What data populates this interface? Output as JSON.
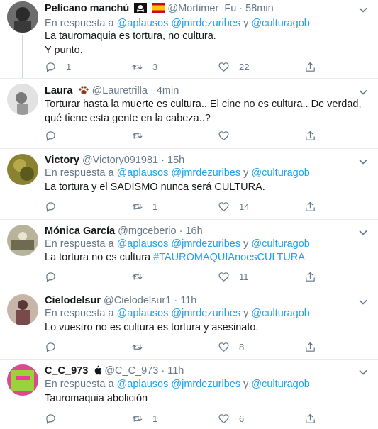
{
  "tweets": [
    {
      "name": "Pelícano manchú",
      "badges": [
        "pirate-flag-icon",
        "spain-flag-icon"
      ],
      "handle": "@Mortimer_Fu",
      "dot": "·",
      "time": "58min",
      "reply_prefix": "En respuesta a",
      "reply_mentions": [
        "@aplausos",
        "@jmrdezuribes",
        "@culturagob"
      ],
      "reply_joiner": "y",
      "text_lines": [
        "La tauromaquia es tortura, no cultura.",
        "Y punto."
      ],
      "replies": "1",
      "retweets": "3",
      "likes": "22",
      "avatar_color": "#5a5a5a"
    },
    {
      "name": "Laura",
      "badges": [
        "paw-print-icon"
      ],
      "handle": "@Lauretrilla",
      "dot": "·",
      "time": "4min",
      "reply_prefix": "",
      "reply_mentions": [],
      "reply_joiner": "",
      "text_lines": [
        "Torturar hasta la muerte es cultura.. El cine no es cultura.. De verdad,",
        "qué tiene esta gente en la cabeza..?"
      ],
      "replies": "",
      "retweets": "",
      "likes": "",
      "avatar_color": "#9a9a9a"
    },
    {
      "name": "Victory",
      "badges": [],
      "handle": "@Victory091981",
      "dot": "·",
      "time": "15h",
      "reply_prefix": "En respuesta a",
      "reply_mentions": [
        "@aplausos",
        "@jmrdezuribes",
        "@culturagob"
      ],
      "reply_joiner": "y",
      "text_lines": [
        "La tortura y el SADISMO nunca será CULTURA."
      ],
      "replies": "",
      "retweets": "1",
      "likes": "14",
      "avatar_color": "#7c7a2a"
    },
    {
      "name": "Mónica García",
      "badges": [],
      "handle": "@mgceberio",
      "dot": "·",
      "time": "16h",
      "reply_prefix": "En respuesta a",
      "reply_mentions": [
        "@aplausos",
        "@jmrdezuribes",
        "@culturagob"
      ],
      "reply_joiner": "y",
      "text_prefix": "La tortura no es cultura ",
      "hashtag": "#TAUROMAQUIAnoesCULTURA",
      "text_lines": [],
      "replies": "",
      "retweets": "",
      "likes": "11",
      "avatar_color": "#8f8f7a"
    },
    {
      "name": "Cielodelsur",
      "badges": [],
      "handle": "@Cielodelsur1",
      "dot": "·",
      "time": "11h",
      "reply_prefix": "En respuesta a",
      "reply_mentions": [
        "@aplausos",
        "@jmrdezuribes",
        "@culturagob"
      ],
      "reply_joiner": "y",
      "text_lines": [
        "Lo vuestro no es cultura es tortura y asesinato."
      ],
      "replies": "",
      "retweets": "",
      "likes": "8",
      "avatar_color": "#6b4a4a"
    },
    {
      "name": "C_C_973",
      "badges": [
        "apple-logo-icon"
      ],
      "handle": "@C_C_973",
      "dot": "·",
      "time": "11h",
      "reply_prefix": "En respuesta a",
      "reply_mentions": [
        "@aplausos",
        "@jmrdezuribes",
        "@culturagob"
      ],
      "reply_joiner": "y",
      "text_lines": [
        "Tauromaquia abolición"
      ],
      "replies": "",
      "retweets": "1",
      "likes": "6",
      "avatar_color": "#6f9a3a"
    }
  ],
  "colors": {
    "link": "#1da1f2",
    "muted": "#657786",
    "divider": "#e6ecf0"
  }
}
